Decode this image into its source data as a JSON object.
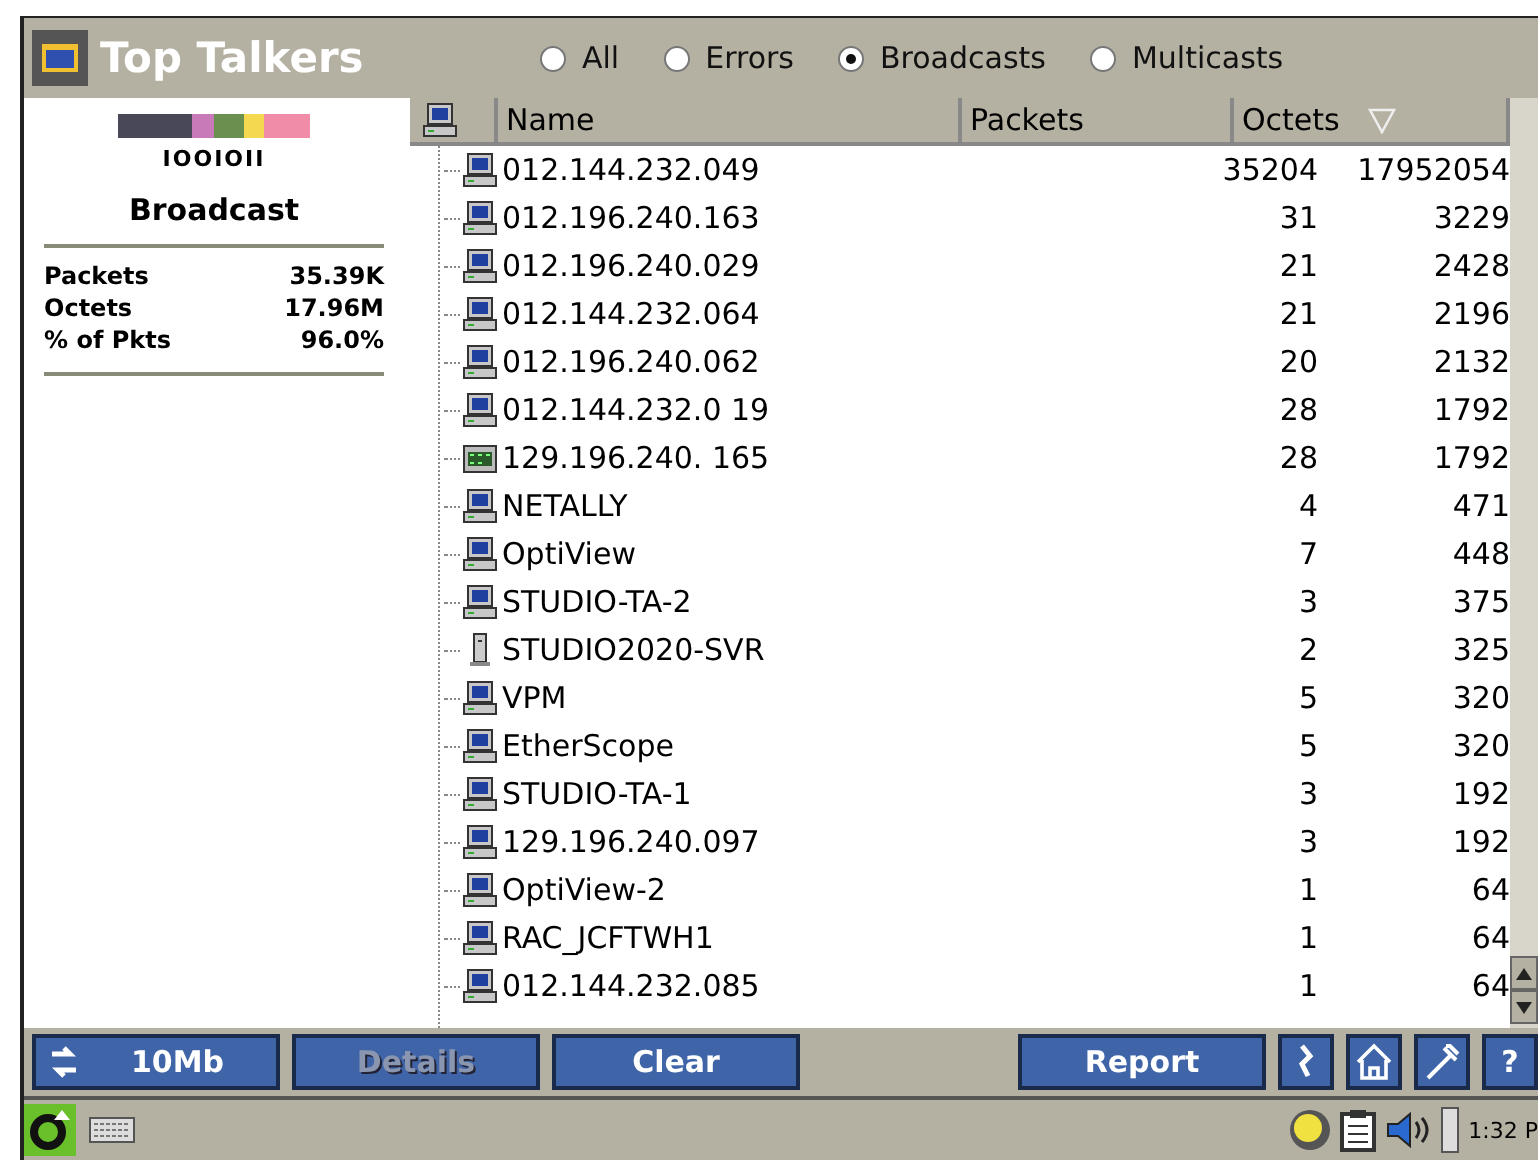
{
  "window": {
    "title": "Top Talkers"
  },
  "filters": [
    {
      "label": "All",
      "selected": false
    },
    {
      "label": "Errors",
      "selected": false
    },
    {
      "label": "Broadcasts",
      "selected": true
    },
    {
      "label": "Multicasts",
      "selected": false
    }
  ],
  "summary": {
    "color_bar": [
      {
        "color": "#484858"
      },
      {
        "color": "#c87ab8"
      },
      {
        "color": "#6a9050"
      },
      {
        "color": "#f4d850"
      },
      {
        "color": "#f08ca8"
      }
    ],
    "bits": "IOOIOII",
    "heading": "Broadcast",
    "stats": [
      {
        "label": "Packets",
        "value": "35.39K"
      },
      {
        "label": "Octets",
        "value": "17.96M"
      },
      {
        "label": "% of Pkts",
        "value": "96.0%"
      }
    ]
  },
  "table": {
    "columns": [
      "Name",
      "Packets",
      "Octets"
    ],
    "rows": [
      {
        "kind": "pc",
        "name": "012.144.232.049",
        "packets": "35204",
        "octets": "17952054"
      },
      {
        "kind": "pc",
        "name": "012.196.240.163",
        "packets": "31",
        "octets": "3229"
      },
      {
        "kind": "pc",
        "name": "012.196.240.029",
        "packets": "21",
        "octets": "2428"
      },
      {
        "kind": "pc",
        "name": "012.144.232.064",
        "packets": "21",
        "octets": "2196"
      },
      {
        "kind": "pc",
        "name": "012.196.240.062",
        "packets": "20",
        "octets": "2132"
      },
      {
        "kind": "pc",
        "name": "012.144.232.0 19",
        "packets": "28",
        "octets": "1792"
      },
      {
        "kind": "switch",
        "name": "129.196.240. 165",
        "packets": "28",
        "octets": "1792"
      },
      {
        "kind": "pc",
        "name": "NETALLY",
        "packets": "4",
        "octets": "471"
      },
      {
        "kind": "pc",
        "name": "OptiView",
        "packets": "7",
        "octets": "448"
      },
      {
        "kind": "pc",
        "name": "STUDIO-TA-2",
        "packets": "3",
        "octets": "375"
      },
      {
        "kind": "server",
        "name": "STUDIO2020-SVR",
        "packets": "2",
        "octets": "325"
      },
      {
        "kind": "pc",
        "name": "VPM",
        "packets": "5",
        "octets": "320"
      },
      {
        "kind": "pc",
        "name": "EtherScope",
        "packets": "5",
        "octets": "320"
      },
      {
        "kind": "pc",
        "name": "STUDIO-TA-1",
        "packets": "3",
        "octets": "192"
      },
      {
        "kind": "pc",
        "name": "129.196.240.097",
        "packets": "3",
        "octets": "192"
      },
      {
        "kind": "pc",
        "name": "OptiView-2",
        "packets": "1",
        "octets": "64"
      },
      {
        "kind": "pc",
        "name": "RAC_JCFTWH1",
        "packets": "1",
        "octets": "64"
      },
      {
        "kind": "pc",
        "name": "012.144.232.085",
        "packets": "1",
        "octets": "64"
      }
    ]
  },
  "buttons": [
    {
      "kind": "speed",
      "label": "10Mb",
      "disabled": false
    },
    {
      "kind": "text",
      "label": "Details",
      "disabled": true
    },
    {
      "kind": "text",
      "label": "Clear",
      "disabled": false
    },
    {
      "kind": "spacer"
    },
    {
      "kind": "text",
      "label": "Report",
      "disabled": false
    },
    {
      "kind": "back"
    },
    {
      "kind": "home"
    },
    {
      "kind": "tools"
    },
    {
      "kind": "help",
      "label": "?",
      "disabled": false
    }
  ],
  "taskbar": {
    "clock": "1:32 P"
  }
}
